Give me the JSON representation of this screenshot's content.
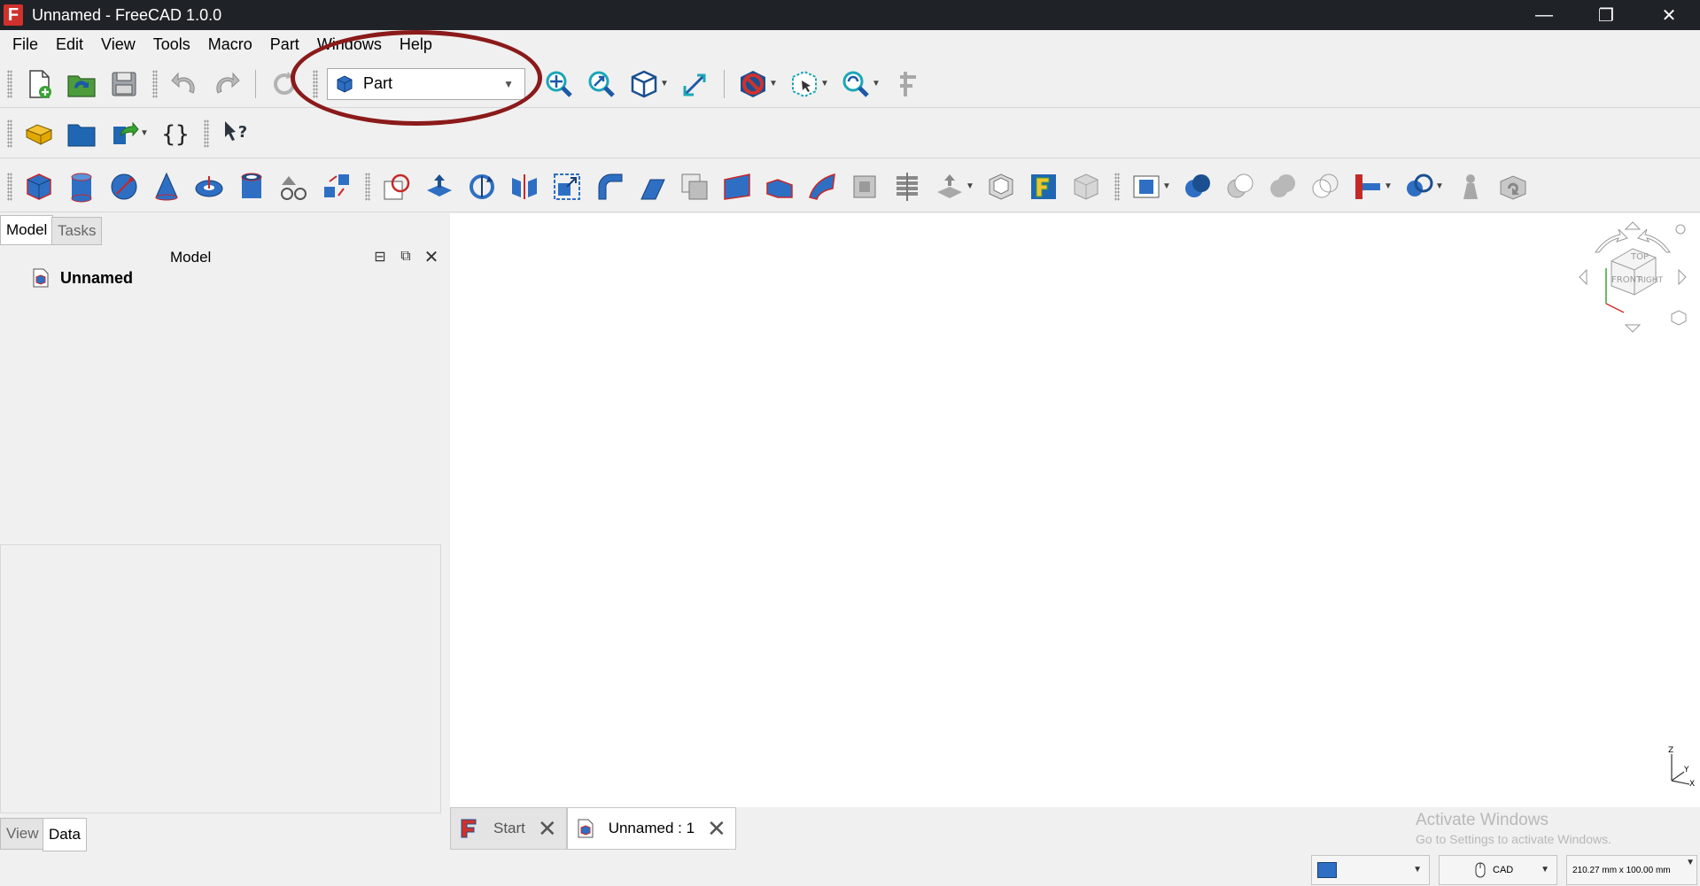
{
  "window": {
    "title": "Unnamed - FreeCAD 1.0.0",
    "logo_letter": "F",
    "minimize": "—",
    "maximize": "❐",
    "close": "✕"
  },
  "menu": [
    "File",
    "Edit",
    "View",
    "Tools",
    "Macro",
    "Part",
    "Windows",
    "Help"
  ],
  "workbench_selector": {
    "value": "Part",
    "icon": "part-cube-icon"
  },
  "left_panel": {
    "tabs": [
      "Model",
      "Tasks"
    ],
    "title": "Model",
    "tree": [
      {
        "label": "Unnamed",
        "icon": "document-icon"
      }
    ],
    "bottom_tabs": [
      "View",
      "Data"
    ]
  },
  "doc_tabs": [
    {
      "label": "Start",
      "active": false
    },
    {
      "label": "Unnamed : 1",
      "active": true
    }
  ],
  "watermark": {
    "line1": "Activate Windows",
    "line2": "Go to Settings to activate Windows."
  },
  "status": {
    "nav_style": "CAD",
    "dimensions": "210.27 mm x 100.00 mm"
  },
  "navcube": {
    "top": "TOP",
    "front": "FRONT",
    "right": "RIGHT"
  },
  "axes": {
    "z": "Z",
    "y": "Y",
    "x": "X"
  },
  "colors": {
    "titlebar": "#1f2227",
    "annotation": "#8b1a1a",
    "part_blue": "#2e6fc4",
    "part_red": "#c62828"
  }
}
